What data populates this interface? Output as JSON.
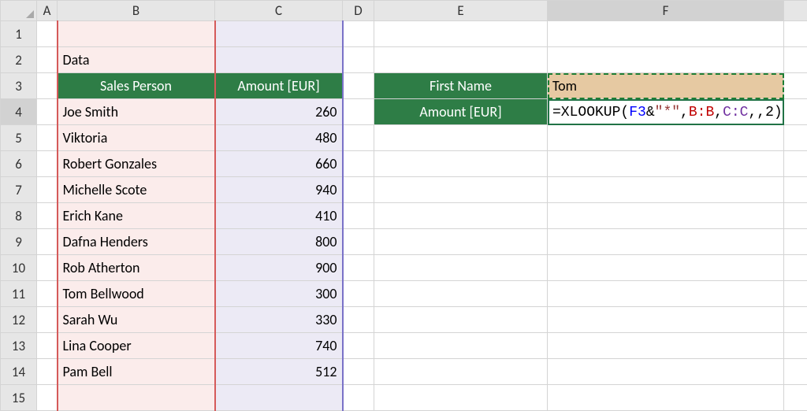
{
  "columns": {
    "A": "A",
    "B": "B",
    "C": "C",
    "D": "D",
    "E": "E",
    "F": "F"
  },
  "rows": [
    "1",
    "2",
    "3",
    "4",
    "5",
    "6",
    "7",
    "8",
    "9",
    "10",
    "11",
    "12",
    "13",
    "14",
    "15"
  ],
  "dataLabel": "Data",
  "headers": {
    "salesPerson": "Sales Person",
    "amount": "Amount [EUR]",
    "firstName": "First Name",
    "amount2": "Amount [EUR]"
  },
  "lookup": {
    "firstNameValue": "Tom",
    "formula_plain": "=XLOOKUP(F3&\"*\",B:B,C:C,,2)",
    "formula_tokens": [
      {
        "t": "=XLOOKUP(",
        "c": "black"
      },
      {
        "t": "F3",
        "c": "blue"
      },
      {
        "t": "&",
        "c": "black"
      },
      {
        "t": "\"*\"",
        "c": "brown"
      },
      {
        "t": ",",
        "c": "black"
      },
      {
        "t": "B:B",
        "c": "red"
      },
      {
        "t": ",",
        "c": "black"
      },
      {
        "t": "C:C",
        "c": "purple"
      },
      {
        "t": ",,2)",
        "c": "black"
      }
    ]
  },
  "chart_data": {
    "type": "table",
    "title": "Data",
    "columns": [
      "Sales Person",
      "Amount [EUR]"
    ],
    "rows": [
      {
        "person": "Joe Smith",
        "amount": 260
      },
      {
        "person": "Viktoria",
        "amount": 480
      },
      {
        "person": "Robert Gonzales",
        "amount": 660
      },
      {
        "person": "Michelle Scote",
        "amount": 940
      },
      {
        "person": "Erich Kane",
        "amount": 410
      },
      {
        "person": "Dafna Henders",
        "amount": 800
      },
      {
        "person": "Rob Atherton",
        "amount": 900
      },
      {
        "person": "Tom Bellwood",
        "amount": 300
      },
      {
        "person": "Sarah Wu",
        "amount": 330
      },
      {
        "person": "Lina Cooper",
        "amount": 740
      },
      {
        "person": "Pam Bell",
        "amount": 512
      }
    ]
  }
}
